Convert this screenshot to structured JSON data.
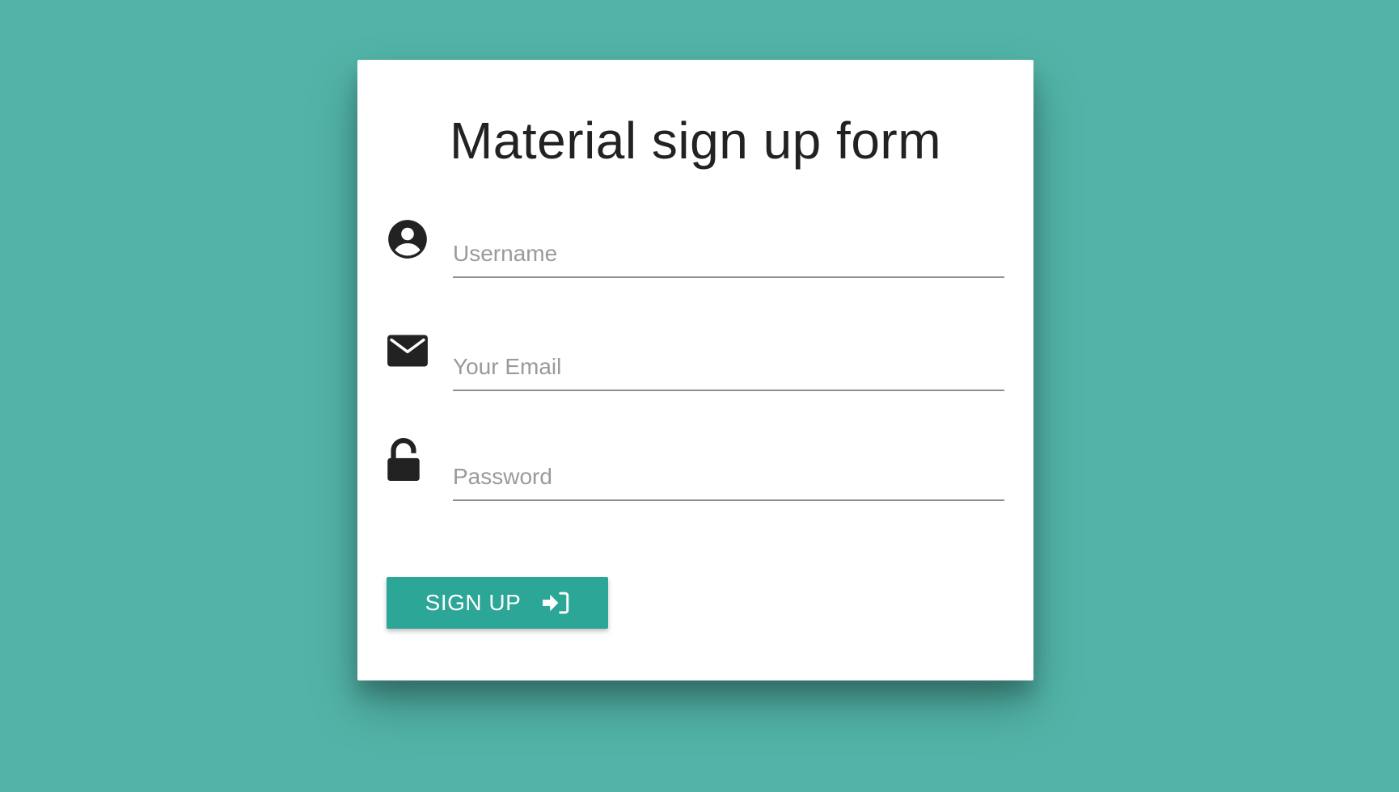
{
  "form": {
    "title": "Material sign up form",
    "fields": [
      {
        "name": "username",
        "icon": "account-circle-icon",
        "placeholder": "Username",
        "value": ""
      },
      {
        "name": "email",
        "icon": "mail-icon",
        "placeholder": "Your Email",
        "value": ""
      },
      {
        "name": "password",
        "icon": "unlock-icon",
        "placeholder": "Password",
        "value": ""
      }
    ],
    "submit": {
      "label": "SIGN UP",
      "icon": "sign-in-icon"
    }
  },
  "colors": {
    "background": "#52b4a8",
    "card": "#ffffff",
    "accent": "#2ca697",
    "text": "#222222",
    "placeholder": "#9a9a9a"
  }
}
